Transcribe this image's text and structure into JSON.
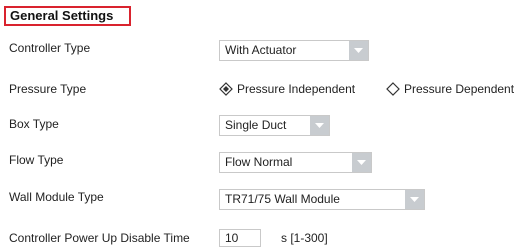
{
  "section": {
    "title": "General Settings"
  },
  "fields": {
    "controller_type": {
      "label": "Controller Type",
      "value": "With Actuator"
    },
    "pressure_type": {
      "label": "Pressure Type",
      "options": [
        {
          "label": "Pressure Independent",
          "selected": true
        },
        {
          "label": "Pressure Dependent",
          "selected": false
        }
      ]
    },
    "box_type": {
      "label": "Box Type",
      "value": "Single Duct"
    },
    "flow_type": {
      "label": "Flow Type",
      "value": "Flow Normal"
    },
    "wall_module_type": {
      "label": "Wall Module Type",
      "value": "TR71/75 Wall Module"
    },
    "power_up_disable_time": {
      "label": "Controller Power Up Disable Time",
      "value": "10",
      "unit": "s [1-300]"
    }
  },
  "icons": {
    "dropdown": "chevron-down-icon",
    "radio_selected": "radio-diamond-selected-icon",
    "radio_unselected": "radio-diamond-unselected-icon"
  },
  "colors": {
    "section_border": "#d9232e",
    "dropdown_button": "#c8ccd0",
    "field_border": "#c9c9c9"
  }
}
